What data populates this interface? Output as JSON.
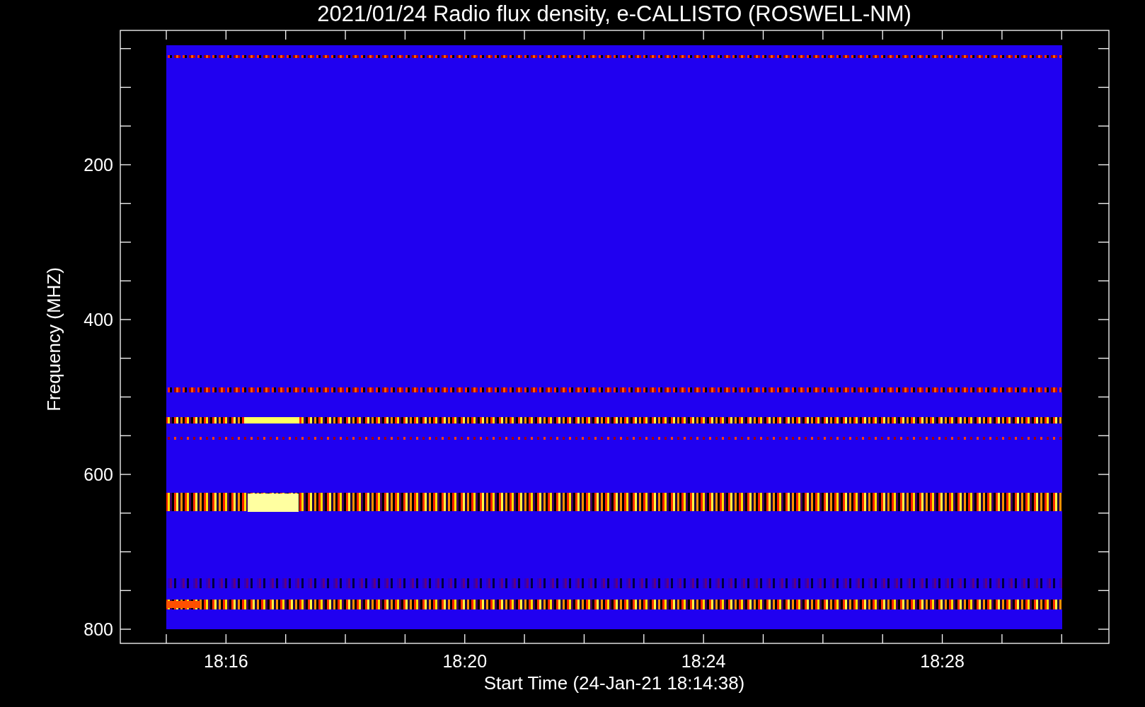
{
  "title": "2021/01/24  Radio flux density, e-CALLISTO (ROSWELL-NM)",
  "ylabel": "Frequency (MHZ)",
  "xlabel": "Start Time (24-Jan-21 18:14:38)",
  "yticks": [
    "200",
    "400",
    "600",
    "800"
  ],
  "xticks": [
    "18:16",
    "18:20",
    "18:24",
    "18:28"
  ]
}
